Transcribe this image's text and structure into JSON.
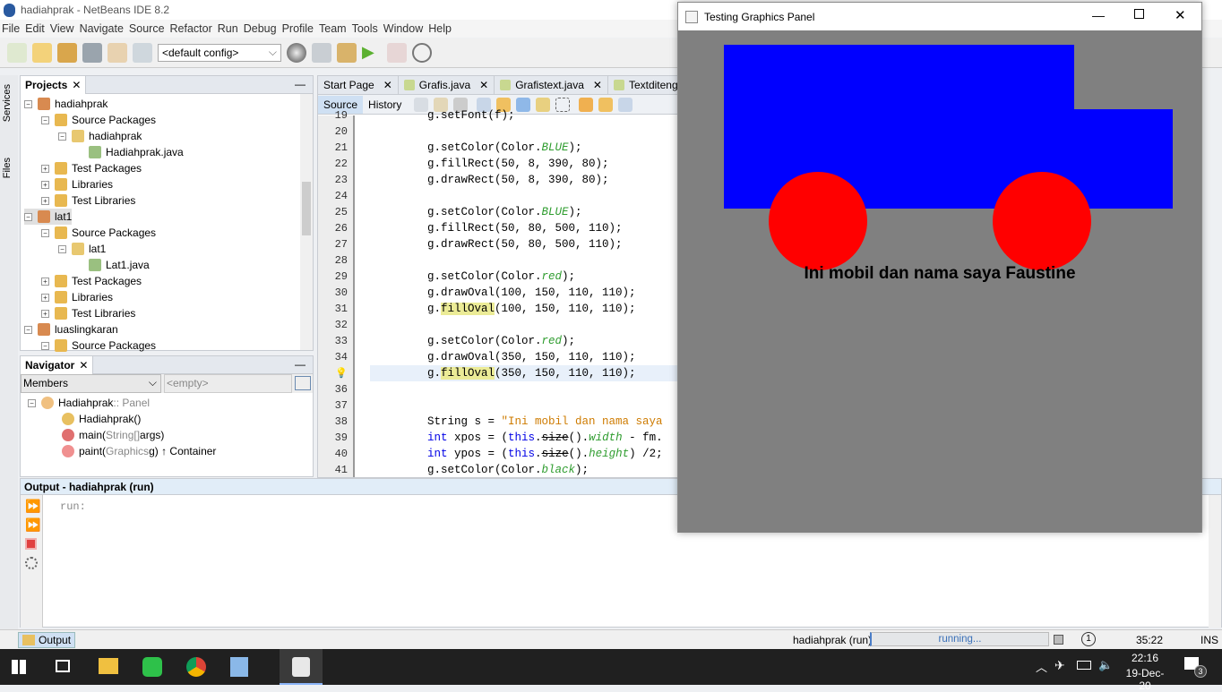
{
  "ide": {
    "title": "hadiahprak - NetBeans IDE 8.2",
    "menu": [
      "File",
      "Edit",
      "View",
      "Navigate",
      "Source",
      "Refactor",
      "Run",
      "Debug",
      "Profile",
      "Team",
      "Tools",
      "Window",
      "Help"
    ],
    "config": "<default config>",
    "side_tabs": [
      "Services",
      "Files"
    ]
  },
  "projects": {
    "title": "Projects",
    "items": [
      {
        "label": "hadiahprak",
        "indent": 0,
        "icon": "project-icon"
      },
      {
        "label": "Source Packages",
        "indent": 1,
        "icon": "folder-icon"
      },
      {
        "label": "hadiahprak",
        "indent": 2,
        "icon": "package-icon"
      },
      {
        "label": "Hadiahprak.java",
        "indent": 3,
        "icon": "java-file-icon"
      },
      {
        "label": "Test Packages",
        "indent": 1,
        "icon": "folder-icon"
      },
      {
        "label": "Libraries",
        "indent": 1,
        "icon": "folder-icon"
      },
      {
        "label": "Test Libraries",
        "indent": 1,
        "icon": "folder-icon"
      },
      {
        "label": "lat1",
        "indent": 0,
        "icon": "project-icon",
        "selected": true
      },
      {
        "label": "Source Packages",
        "indent": 1,
        "icon": "folder-icon"
      },
      {
        "label": "lat1",
        "indent": 2,
        "icon": "package-icon"
      },
      {
        "label": "Lat1.java",
        "indent": 3,
        "icon": "java-file-icon"
      },
      {
        "label": "Test Packages",
        "indent": 1,
        "icon": "folder-icon"
      },
      {
        "label": "Libraries",
        "indent": 1,
        "icon": "folder-icon"
      },
      {
        "label": "Test Libraries",
        "indent": 1,
        "icon": "folder-icon"
      },
      {
        "label": "luaslingkaran",
        "indent": 0,
        "icon": "project-icon"
      },
      {
        "label": "Source Packages",
        "indent": 1,
        "icon": "folder-icon"
      }
    ]
  },
  "navigator": {
    "title": "Navigator",
    "filter": "Members",
    "filter2": "<empty>",
    "items": [
      {
        "name": "Hadiahprak",
        "type": " :: Panel",
        "indent": 0,
        "icon": "class-icon"
      },
      {
        "name": "Hadiahprak()",
        "type": "",
        "indent": 1,
        "icon": "constructor-icon"
      },
      {
        "name": "main(",
        "type": "String[]",
        "rest": " args)",
        "indent": 1,
        "icon": "static-method-icon"
      },
      {
        "name": "paint(",
        "type": "Graphics",
        "rest": " g) ↑ Container",
        "indent": 1,
        "icon": "method-icon"
      }
    ]
  },
  "editor": {
    "tabs": [
      "Start Page",
      "Grafis.java",
      "Grafistext.java",
      "Textditengah.j"
    ],
    "source_tab": "Source",
    "history_tab": "History",
    "lines": [
      {
        "n": "19",
        "s": [
          [
            "g.setFont(f);",
            ""
          ]
        ]
      },
      {
        "n": "20",
        "s": []
      },
      {
        "n": "21",
        "s": [
          [
            "g.setColor(Color.",
            ""
          ],
          [
            "BLUE",
            "fld"
          ],
          [
            ");",
            ""
          ]
        ]
      },
      {
        "n": "22",
        "s": [
          [
            "g.fillRect(50, 8, 390, 80);",
            ""
          ]
        ]
      },
      {
        "n": "23",
        "s": [
          [
            "g.drawRect(50, 8, 390, 80);",
            ""
          ]
        ]
      },
      {
        "n": "24",
        "s": []
      },
      {
        "n": "25",
        "s": [
          [
            "g.setColor(Color.",
            ""
          ],
          [
            "BLUE",
            "fld"
          ],
          [
            ");",
            ""
          ]
        ]
      },
      {
        "n": "26",
        "s": [
          [
            "g.fillRect(50, 80, 500, 110);",
            ""
          ]
        ]
      },
      {
        "n": "27",
        "s": [
          [
            "g.drawRect(50, 80, 500, 110);",
            ""
          ]
        ]
      },
      {
        "n": "28",
        "s": []
      },
      {
        "n": "29",
        "s": [
          [
            "g.setColor(Color.",
            ""
          ],
          [
            "red",
            "fld"
          ],
          [
            ");",
            ""
          ]
        ]
      },
      {
        "n": "30",
        "s": [
          [
            "g.drawOval(100, 150, 110, 110);",
            ""
          ]
        ]
      },
      {
        "n": "31",
        "s": [
          [
            "g.",
            ""
          ],
          [
            "fillOval",
            "hl"
          ],
          [
            "(100, 150, 110, 110);",
            ""
          ]
        ]
      },
      {
        "n": "32",
        "s": []
      },
      {
        "n": "33",
        "s": [
          [
            "g.setColor(Color.",
            ""
          ],
          [
            "red",
            "fld"
          ],
          [
            ");",
            ""
          ]
        ]
      },
      {
        "n": "34",
        "s": [
          [
            "g.drawOval(350, 150, 110, 110);",
            ""
          ]
        ]
      },
      {
        "n": "",
        "s": [
          [
            "g.",
            ""
          ],
          [
            "fillOval",
            "hl"
          ],
          [
            "(350, 150, 110, 110);",
            ""
          ]
        ],
        "current": true
      },
      {
        "n": "36",
        "s": []
      },
      {
        "n": "37",
        "s": []
      },
      {
        "n": "38",
        "s": [
          [
            "String s = ",
            ""
          ],
          [
            "\"Ini mobil dan nama saya",
            "str"
          ]
        ]
      },
      {
        "n": "39",
        "s": [
          [
            "int",
            "kw"
          ],
          [
            " xpos = (",
            ""
          ],
          [
            "this",
            "kw"
          ],
          [
            ".",
            ""
          ],
          [
            "size",
            "strike"
          ],
          [
            "().",
            ""
          ],
          [
            "width",
            "fld"
          ],
          [
            " - fm.",
            ""
          ]
        ]
      },
      {
        "n": "40",
        "s": [
          [
            "int",
            "kw"
          ],
          [
            " ypos = (",
            ""
          ],
          [
            "this",
            "kw"
          ],
          [
            ".",
            ""
          ],
          [
            "size",
            "strike"
          ],
          [
            "().",
            ""
          ],
          [
            "height",
            "fld"
          ],
          [
            ") /2;",
            ""
          ]
        ]
      },
      {
        "n": "41",
        "s": [
          [
            "g.setColor(Color.",
            ""
          ],
          [
            "black",
            "fld"
          ],
          [
            ");",
            ""
          ]
        ]
      }
    ]
  },
  "output": {
    "title": "Output - hadiahprak (run)",
    "text": "run:",
    "tab": "Output"
  },
  "status": {
    "task": "hadiahprak (run)",
    "progress": "running...",
    "notifications": "1",
    "position": "35:22",
    "mode": "INS"
  },
  "taskbar": {
    "time": "22:16",
    "date": "19-Dec-20",
    "notif_count": "3"
  },
  "graphics_window": {
    "title": "Testing Graphics Panel",
    "text": "Ini mobil dan nama saya Faustine",
    "colors": {
      "background": "#808080",
      "body": "#0000ff",
      "wheels": "#ff0000",
      "text": "#000000"
    },
    "shapes": {
      "rects": [
        [
          50,
          8,
          390,
          80
        ],
        [
          50,
          80,
          500,
          110
        ]
      ],
      "ovals": [
        [
          100,
          150,
          110,
          110
        ],
        [
          350,
          150,
          110,
          110
        ]
      ]
    }
  }
}
